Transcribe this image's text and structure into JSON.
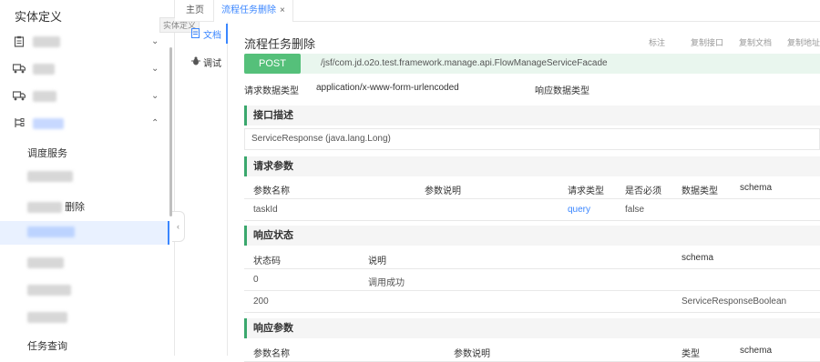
{
  "sidebar": {
    "title": "实体定义",
    "tooltip": "实体定义",
    "groups": [
      {
        "label": "",
        "icon": "clipboard-icon",
        "chevron": "⌄"
      },
      {
        "label": "",
        "icon": "truck-icon",
        "chevron": "⌄"
      },
      {
        "label": "",
        "icon": "truck-icon",
        "chevron": "⌄"
      },
      {
        "label": "",
        "icon": "flow-icon",
        "chevron": "⌃"
      }
    ],
    "items": [
      {
        "label": "调度服务"
      },
      {
        "label": ""
      },
      {
        "label": "删除"
      },
      {
        "label": "",
        "active": true
      },
      {
        "label": ""
      },
      {
        "label": ""
      },
      {
        "label": ""
      },
      {
        "label": "任务查询"
      }
    ],
    "collapse_glyph": "‹"
  },
  "tabs": {
    "home": "主页",
    "active": "流程任务删除",
    "close": "×"
  },
  "subnav": {
    "doc": "文档",
    "debug": "调试"
  },
  "main": {
    "title": "流程任务删除",
    "tools": [
      "标注",
      "复制接口",
      "复制文档",
      "复制地址"
    ],
    "method": "POST",
    "path": "/jsf/com.jd.o2o.test.framework.manage.api.FlowManageServiceFacade",
    "request_type_label": "请求数据类型",
    "request_type_value": "application/x-www-form-urlencoded",
    "response_type_label": "响应数据类型",
    "sections": {
      "desc": "接口描述",
      "params": "请求参数",
      "status": "响应状态",
      "response": "响应参数"
    },
    "description": "ServiceResponse (java.lang.Long)",
    "params_table": {
      "headers": [
        "参数名称",
        "参数说明",
        "请求类型",
        "是否必须",
        "数据类型",
        "schema"
      ],
      "rows": [
        {
          "name": "taskId",
          "desc": "",
          "type": "query",
          "required": "false",
          "datatype": "",
          "schema": ""
        }
      ]
    },
    "status_table": {
      "headers": [
        "状态码",
        "说明",
        "schema"
      ],
      "rows": [
        {
          "code": "0",
          "desc": "调用成功",
          "schema": ""
        },
        {
          "code": "200",
          "desc": "",
          "schema": "ServiceResponseBoolean"
        }
      ]
    },
    "response_table": {
      "headers": [
        "参数名称",
        "参数说明",
        "类型",
        "schema"
      ]
    }
  },
  "colors": {
    "accent": "#3a86ff",
    "post": "#55c07a",
    "section_border": "#3aa76d"
  }
}
